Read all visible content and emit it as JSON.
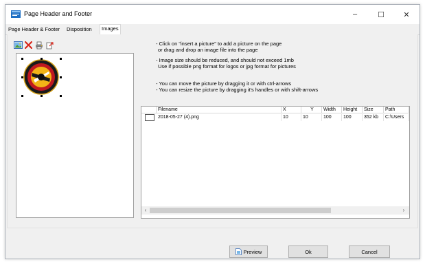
{
  "window": {
    "title": "Page Header and Footer",
    "controls": {
      "minimize": "–",
      "maximize": "☐",
      "close": "✕"
    }
  },
  "tabs": [
    {
      "label": "Page Header & Footer",
      "active": false
    },
    {
      "label": "Disposition",
      "active": false
    },
    {
      "label": "Images",
      "active": true
    }
  ],
  "toolbar": {
    "icons": [
      "insert-picture-icon",
      "delete-picture-icon",
      "print-icon",
      "export-icon"
    ]
  },
  "instructions": [
    "- Click on \"insert a picture\" to add a picture on the page",
    "  or drag and drop an image file into the page",
    "- Image size should be reduced, and should not exceed 1mb",
    "  Use if possible png format for logos or jpg format for pictures",
    "- You can move the picture by dragging it or with ctrl-arrows",
    "- You can resize the picture by dragging it's handles or with shift-arrows"
  ],
  "grid": {
    "columns": [
      "Filename",
      "X",
      "Y",
      "Width",
      "Height",
      "Size",
      "Path"
    ],
    "rows": [
      [
        "2018-05-27 (4).png",
        "10",
        "10",
        "100",
        "100",
        "352 kb",
        "C:\\Users"
      ]
    ]
  },
  "buttons": {
    "preview": "Preview",
    "ok": "Ok",
    "cancel": "Cancel"
  },
  "colors": {
    "accent": "#0078d7",
    "window_bg": "#f0f0f0",
    "button_bg": "#e1e1e1"
  }
}
